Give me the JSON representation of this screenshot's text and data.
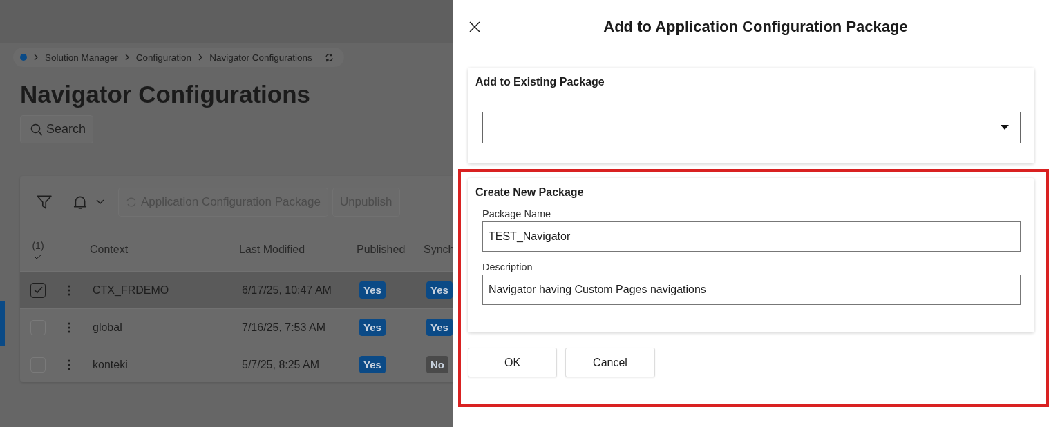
{
  "breadcrumb": {
    "items": [
      "Solution Manager",
      "Configuration",
      "Navigator Configurations"
    ]
  },
  "page_title": "Navigator Configurations",
  "search_button": "Search",
  "toolbar": {
    "actions": [
      {
        "label": "Application Configuration Package",
        "disabled": true
      },
      {
        "label": "Unpublish",
        "disabled": true
      }
    ]
  },
  "table": {
    "selection_count": "(1)",
    "columns": [
      "Context",
      "Last Modified",
      "Published",
      "Synch"
    ],
    "rows": [
      {
        "selected": true,
        "context": "CTX_FRDEMO",
        "last_modified": "6/17/25, 10:47 AM",
        "badges": [
          {
            "text": "Yes",
            "color": "#0b4a86"
          },
          {
            "text": "Yes",
            "color": "#0b4a86"
          }
        ]
      },
      {
        "selected": false,
        "context": "global",
        "last_modified": "7/16/25, 7:53 AM",
        "badges": [
          {
            "text": "Yes",
            "color": "#0b4a86"
          },
          {
            "text": "Yes",
            "color": "#0b4a86"
          }
        ]
      },
      {
        "selected": false,
        "context": "konteki",
        "last_modified": "5/7/25, 8:25 AM",
        "badges": [
          {
            "text": "Yes",
            "color": "#0b4a86"
          },
          {
            "text": "No",
            "color": "#4a4a4a"
          }
        ]
      }
    ]
  },
  "dialog": {
    "title": "Add to Application Configuration Package",
    "existing_package": {
      "title": "Add to Existing Package"
    },
    "new_package": {
      "title": "Create New Package",
      "fields": [
        {
          "label": "Package Name",
          "value": "TEST_Navigator"
        },
        {
          "label": "Description",
          "value": "Navigator having Custom Pages navigations"
        }
      ]
    },
    "buttons": [
      "OK",
      "Cancel"
    ]
  }
}
